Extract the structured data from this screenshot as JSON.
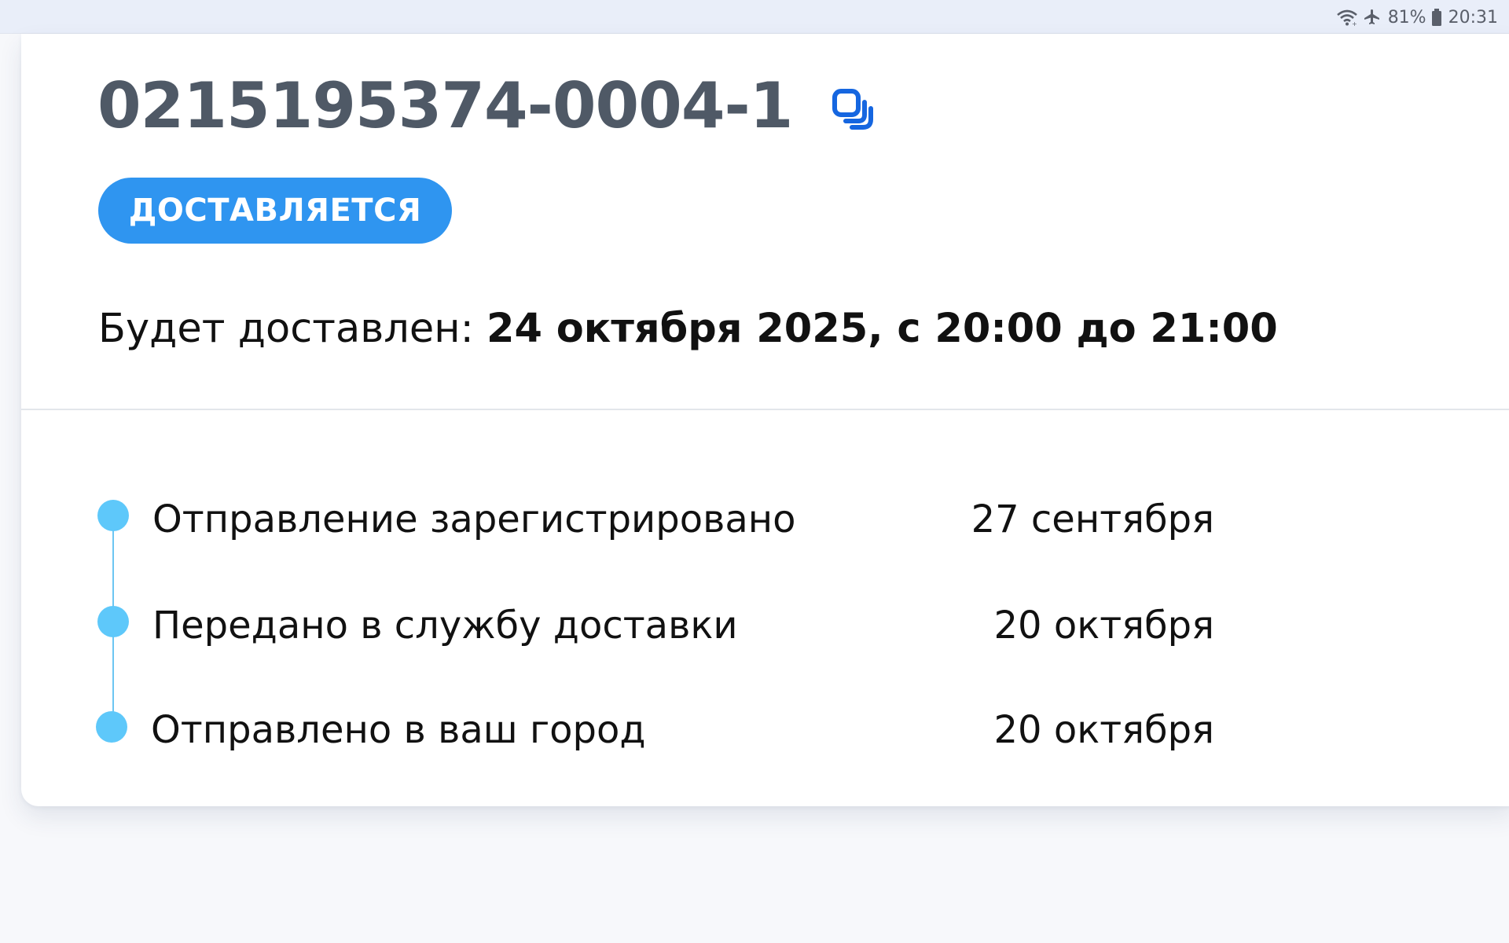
{
  "status_bar": {
    "battery_percent": "81%",
    "time": "20:31",
    "icons": [
      "wifi-icon",
      "airplane-icon",
      "battery-icon"
    ]
  },
  "shipment": {
    "tracking_number": "0215195374-0004-1",
    "status": "ДОСТАВЛЯЕТСЯ",
    "delivery_label": "Будет доставлен:",
    "delivery_value": "24 октября 2025, с 20:00 до 21:00"
  },
  "timeline": [
    {
      "title": "Отправление зарегистрировано",
      "date": "27 сентября"
    },
    {
      "title": "Передано в службу доставки",
      "date": "20 октября"
    },
    {
      "title": "Отправлено в ваш город",
      "date": "20 октября"
    }
  ],
  "colors": {
    "badge": "#2f95f0",
    "copy_icon": "#1566e0",
    "timeline_dot": "#5ec8fa",
    "tracking_number": "#4f5966"
  }
}
